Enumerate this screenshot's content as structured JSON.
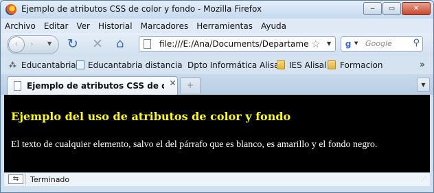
{
  "window": {
    "title": "Ejemplo de atributos CSS de color y fondo - Mozilla Firefox",
    "minimize_glyph": "‒",
    "maximize_glyph": "▭",
    "close_glyph": "✕"
  },
  "menu": [
    {
      "label": "Archivo"
    },
    {
      "label": "Editar"
    },
    {
      "label": "Ver"
    },
    {
      "label": "Historial"
    },
    {
      "label": "Marcadores"
    },
    {
      "label": "Herramientas"
    },
    {
      "label": "Ayuda"
    }
  ],
  "navbar": {
    "back_glyph": "‹",
    "forward_glyph": "›",
    "reload_glyph": "↻",
    "stop_glyph": "✕",
    "home_glyph": "⌂",
    "url": "file:///E:/Ana/Documents/Departamento",
    "search_placeholder": "Google"
  },
  "bookmarks": [
    {
      "label": "Educantabria",
      "icon": "educantabria-icon"
    },
    {
      "label": "Educantabria distancia",
      "icon": "page-icon"
    },
    {
      "label": "Dpto Informática Alisal",
      "icon": "bookmark-icon"
    },
    {
      "label": "IES Alisal",
      "icon": "folder-icon"
    },
    {
      "label": "Formacion",
      "icon": "folder-icon"
    }
  ],
  "tab": {
    "title": "Ejemplo de atributos CSS de color y f...",
    "new_tab_glyph": "+"
  },
  "content": {
    "heading": "Ejemplo del uso de atributos de color y fondo",
    "paragraph": "El texto de cualquier elemento, salvo el del párrafo que es blanco, es amarillo y el fondo negro.",
    "heading_color": "#ffff00",
    "text_color": "#ffffff",
    "background_color": "#000000"
  },
  "status": {
    "text": "Terminado"
  }
}
